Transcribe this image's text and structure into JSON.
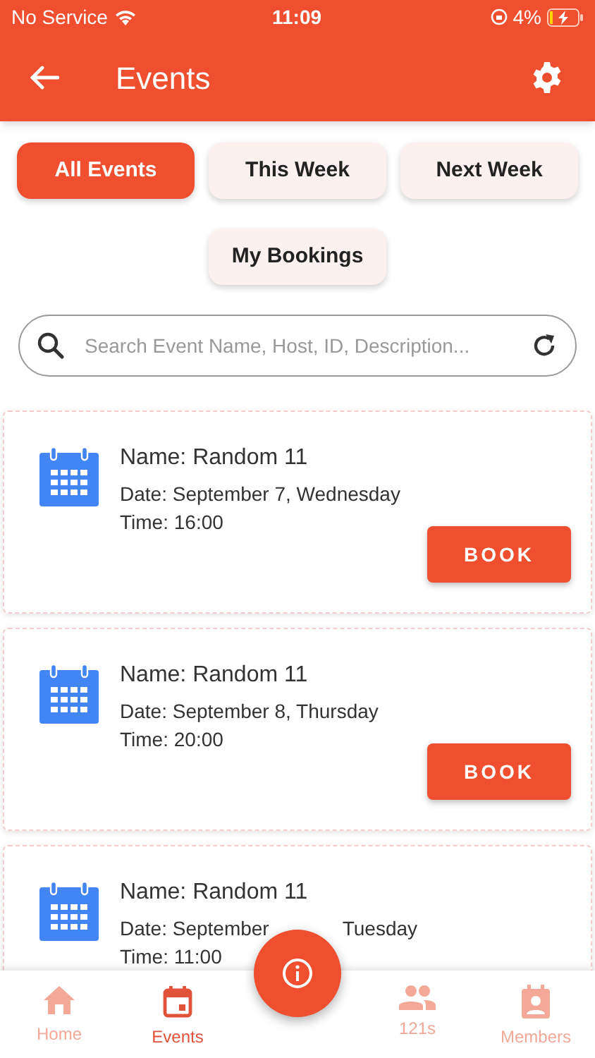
{
  "status_bar": {
    "carrier": "No Service",
    "time": "11:09",
    "battery": "4%"
  },
  "header": {
    "title": "Events"
  },
  "filters": [
    {
      "label": "All Events",
      "selected": true
    },
    {
      "label": "This Week",
      "selected": false
    },
    {
      "label": "Next Week",
      "selected": false
    },
    {
      "label": "My Bookings",
      "selected": false
    }
  ],
  "search": {
    "placeholder": "Search Event Name, Host, ID, Description..."
  },
  "events": [
    {
      "name": "Name: Random 11",
      "date": [
        "Date: September 7, Wednesday"
      ],
      "time": "Time: 16:00",
      "button": "BOOK"
    },
    {
      "name": "Name: Random 11",
      "date": [
        "Date: September 8, Thursday"
      ],
      "time": "Time: 20:00",
      "button": "BOOK"
    },
    {
      "name": "Name: Random 11",
      "date": [
        "Date: September",
        "Tuesday"
      ],
      "time": "Time: 11:00"
    }
  ],
  "bottom_nav": [
    {
      "label": "Home",
      "selected": false
    },
    {
      "label": "Events",
      "selected": true
    },
    {
      "label": "121s",
      "selected": false
    },
    {
      "label": "Members",
      "selected": false
    }
  ]
}
